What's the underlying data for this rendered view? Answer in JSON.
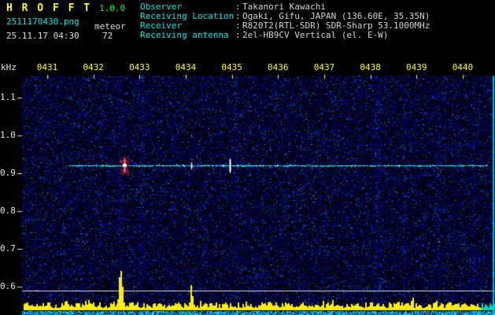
{
  "header": {
    "app_title": "H R O F F T",
    "app_version": "1.0.0",
    "filename": "2511170430.png",
    "mode_label": "meteor",
    "datetime": "25.11.17 04:30",
    "echo_count": "72",
    "separator": ":",
    "info_rows": [
      {
        "label": "Observer",
        "value": "Takanori Kawachi"
      },
      {
        "label": "Receiving Location",
        "value": "Ogaki, Gifu, JAPAN (136.60E, 35.35N)"
      },
      {
        "label": "Receiver",
        "value": "R820T2(RTL-SDR) SDR-Sharp 53.1000MHz"
      },
      {
        "label": "Receiving antenna",
        "value": "2el-HB9CV Vertical (el. E-W)"
      }
    ]
  },
  "colors": {
    "title": "#ffff00",
    "version": "#00ff00",
    "cyan_label": "#00e8e8",
    "value_text": "#d4d4d4",
    "time_ticks": "#ffff00",
    "freq_ticks": "#e4e4e4",
    "carrier": "#00e6e6",
    "echo_strong": "#ff4848",
    "reference_line": "#d8dce8",
    "noise_base": "#0000aa",
    "bottom_strip": "#00c8e6"
  },
  "chart_data": [
    {
      "type": "heatmap",
      "title": "Radio meteor echo spectrogram 04:30-04:40",
      "ylabel": "kHz",
      "x_tick_labels": [
        "0431",
        "0432",
        "0433",
        "0434",
        "0435",
        "0436",
        "0437",
        "0438",
        "0439",
        "0440"
      ],
      "y_tick_labels": [
        "1.1",
        "1.0",
        "0.9",
        "0.8",
        "0.7",
        "0.6"
      ],
      "y_tick_values": [
        1.1,
        1.0,
        0.9,
        0.8,
        0.7,
        0.6
      ],
      "ylim_khz": [
        0.55,
        1.17
      ],
      "grid": false,
      "background": "dark blue speckle noise on black",
      "carrier_frequency_khz": 0.92,
      "carrier_start_min": 1.46,
      "carrier_end_min": 10.55,
      "reference_line_khz": 0.59,
      "echo_events": [
        {
          "time_min": 2.67,
          "frequency_khz": 0.92,
          "intensity": "strong"
        },
        {
          "time_min": 4.12,
          "frequency_khz": 0.92,
          "intensity": "weak"
        },
        {
          "time_min": 4.95,
          "frequency_khz": 0.92,
          "intensity": "medium"
        }
      ]
    },
    {
      "type": "bar",
      "title": "Relative signal level strip",
      "bar_color": "#ffee00",
      "spike_times_min": [
        2.6,
        4.12
      ],
      "description": "dense short yellow bars along bottom edge with two tall spikes; teal bars at far right"
    }
  ]
}
